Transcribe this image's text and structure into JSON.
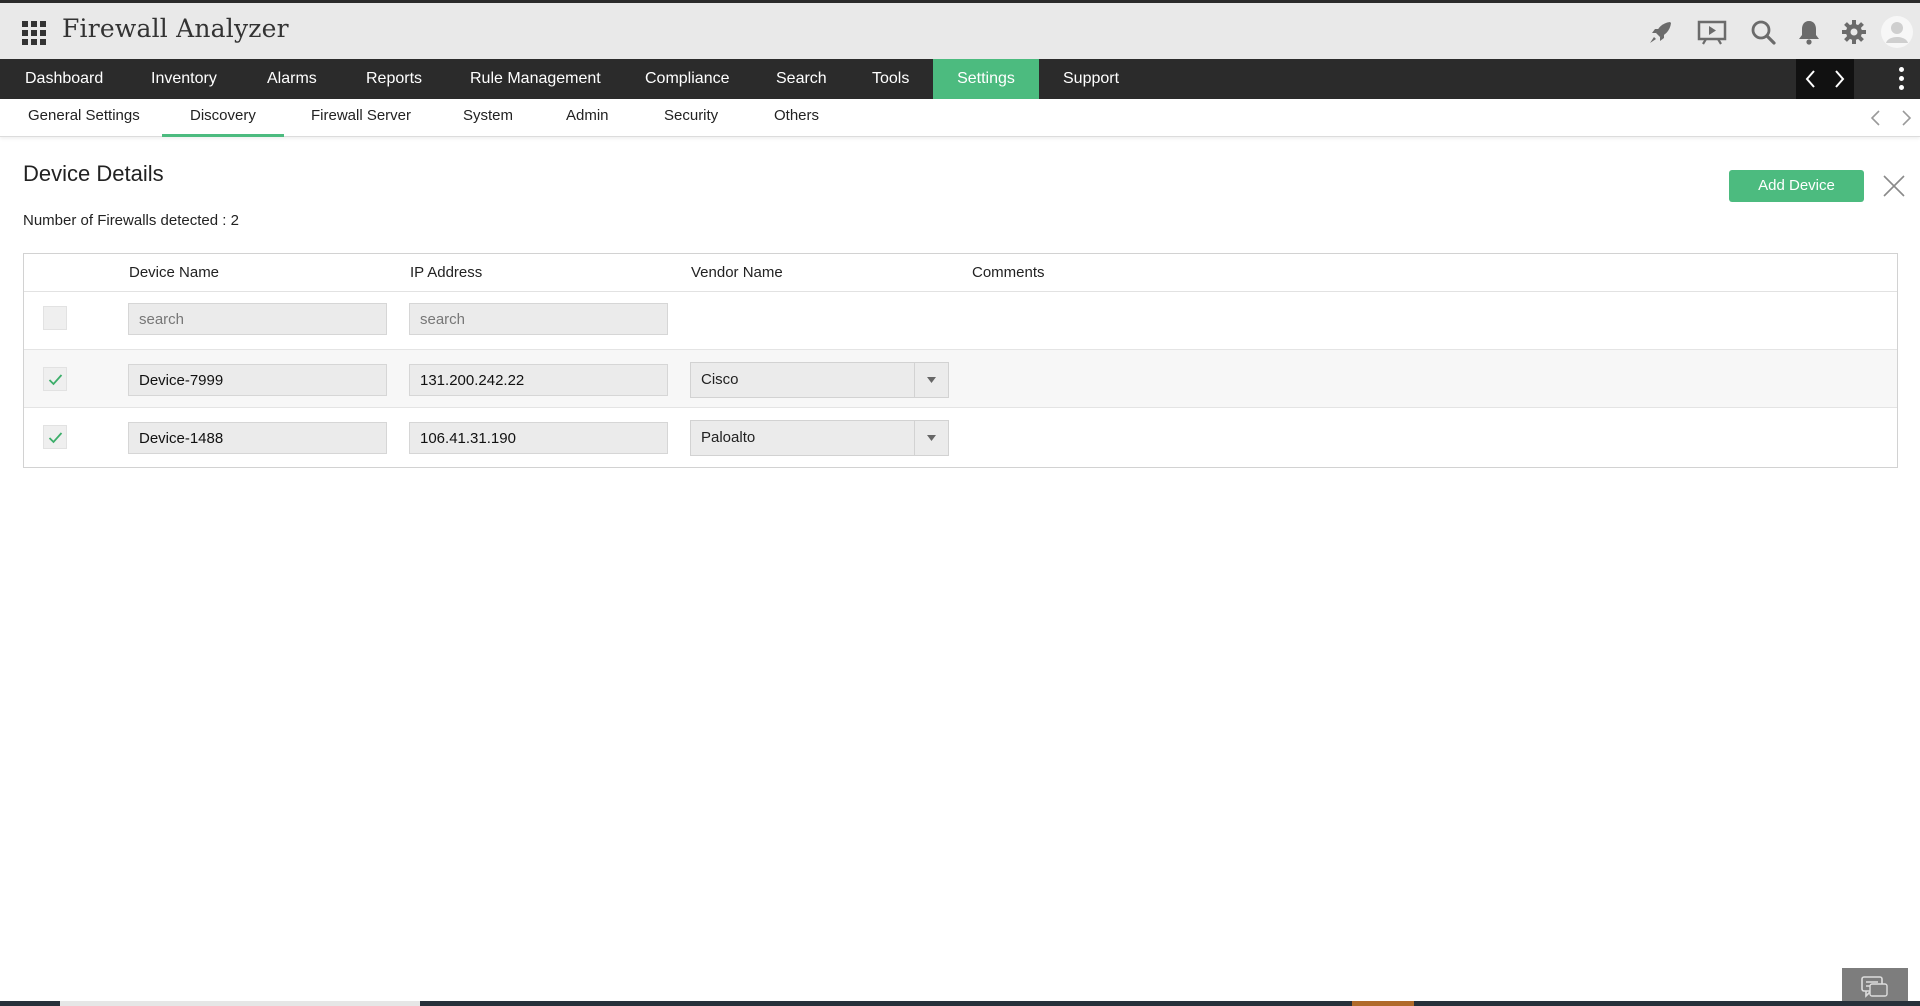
{
  "app": {
    "title": "Firewall Analyzer"
  },
  "header_icons": [
    "rocket-icon",
    "presentation-icon",
    "search-icon",
    "bell-icon",
    "gear-icon",
    "user-avatar-icon"
  ],
  "main_nav": {
    "items": [
      {
        "label": "Dashboard"
      },
      {
        "label": "Inventory"
      },
      {
        "label": "Alarms"
      },
      {
        "label": "Reports"
      },
      {
        "label": "Rule Management"
      },
      {
        "label": "Compliance"
      },
      {
        "label": "Search"
      },
      {
        "label": "Tools"
      },
      {
        "label": "Settings",
        "active": true
      },
      {
        "label": "Support"
      }
    ]
  },
  "sub_nav": {
    "items": [
      {
        "label": "General Settings"
      },
      {
        "label": "Discovery",
        "active": true
      },
      {
        "label": "Firewall Server"
      },
      {
        "label": "System"
      },
      {
        "label": "Admin"
      },
      {
        "label": "Security"
      },
      {
        "label": "Others"
      }
    ]
  },
  "content": {
    "title": "Device Details",
    "firewall_count": "Number of Firewalls detected : 2",
    "add_button": "Add Device"
  },
  "table": {
    "columns": [
      "Device Name",
      "IP Address",
      "Vendor Name",
      "Comments"
    ],
    "filters": {
      "device_placeholder": "search",
      "ip_placeholder": "search"
    },
    "rows": [
      {
        "checked": true,
        "device_name": "Device-7999",
        "ip_address": "131.200.242.22",
        "vendor": "Cisco",
        "comments": ""
      },
      {
        "checked": true,
        "device_name": "Device-1488",
        "ip_address": "106.41.31.190",
        "vendor": "Paloalto",
        "comments": ""
      }
    ]
  },
  "colors": {
    "accent": "#4cbb7f",
    "nav_bg": "#2b2b2b",
    "header_bg": "#e9e9e9",
    "checkmark": "#3cae6a"
  }
}
